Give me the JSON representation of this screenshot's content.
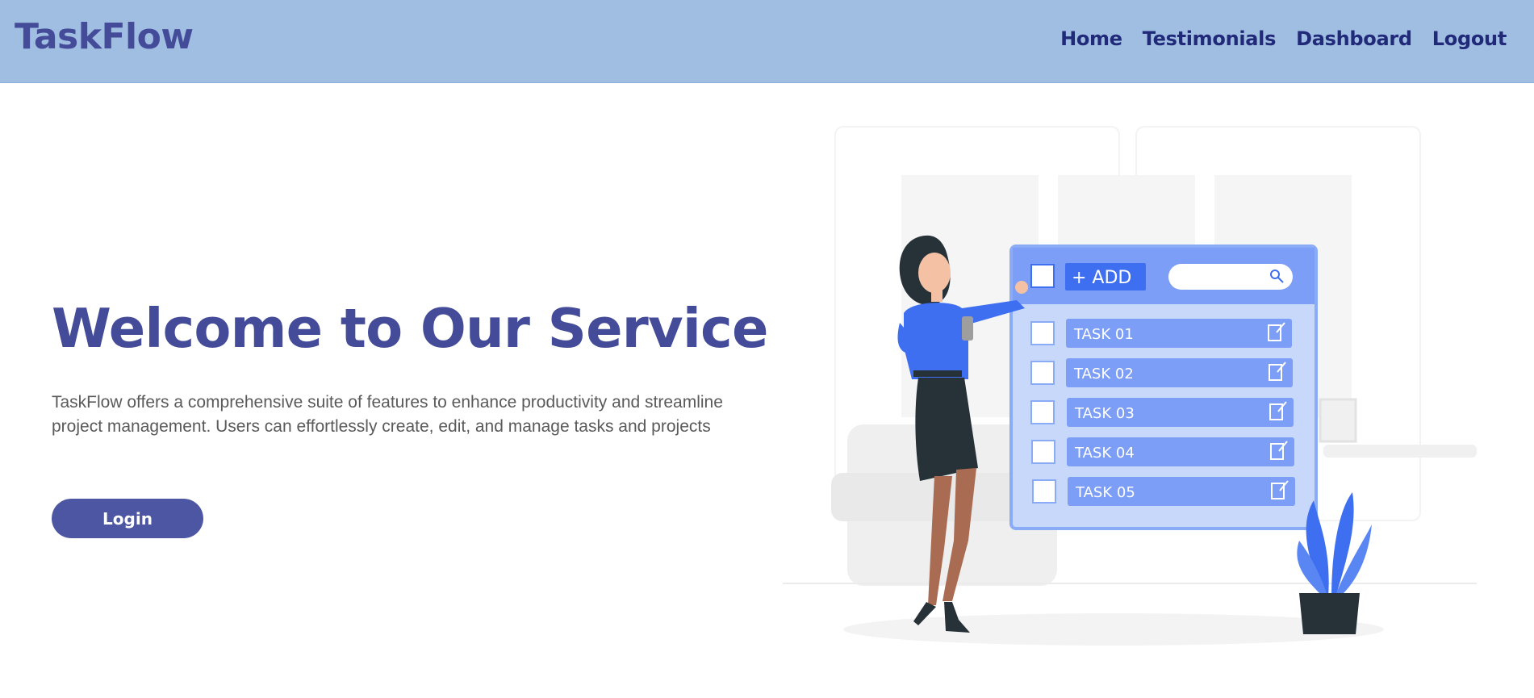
{
  "navbar": {
    "brand": "TaskFlow",
    "links": [
      {
        "label": "Home"
      },
      {
        "label": "Testimonials"
      },
      {
        "label": "Dashboard"
      },
      {
        "label": "Logout"
      }
    ]
  },
  "hero": {
    "title": "Welcome to Our Service",
    "description": "TaskFlow offers a comprehensive suite of features to enhance productivity and streamline project management. Users can effortlessly create, edit, and manage tasks and projects",
    "login_label": "Login"
  },
  "illustration": {
    "add_label": "+ ADD",
    "tasks": [
      "TASK 01",
      "TASK 02",
      "TASK 03",
      "TASK 04",
      "TASK 05"
    ],
    "colors": {
      "panel": "#c8d8fb",
      "panel_border": "#8aabf5",
      "task_bar": "#7c9ef6",
      "accent": "#3e6ff0",
      "skirt": "#263238",
      "skin": "#a96b52"
    }
  }
}
